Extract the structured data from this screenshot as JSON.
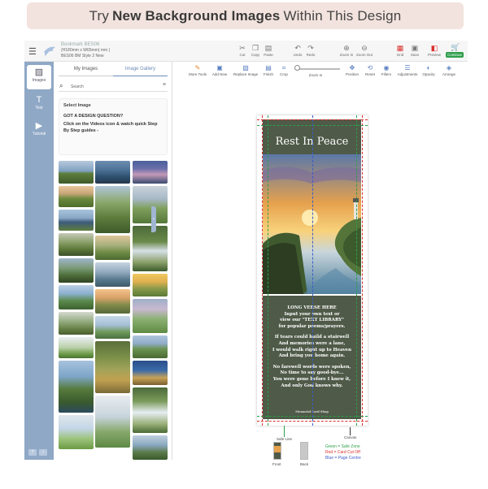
{
  "banner": {
    "prefix": "Try",
    "bold": "New Background Images",
    "suffix": "Within This Design"
  },
  "doc": {
    "name": "Bookmark BES06",
    "size": "(H180mm x W65mm( mm )",
    "style": "BES06 BM Style 2 New"
  },
  "topbar": {
    "buttons": [
      {
        "label": "Cut",
        "icon": "scissors-icon"
      },
      {
        "label": "Copy",
        "icon": "copy-icon"
      },
      {
        "label": "Paste",
        "icon": "paste-icon"
      },
      {
        "label": "Undo",
        "icon": "undo-icon"
      },
      {
        "label": "Redo",
        "icon": "redo-icon"
      },
      {
        "label": "Zoom In",
        "icon": "zoom-in-icon"
      },
      {
        "label": "Zoom Out",
        "icon": "zoom-out-icon"
      },
      {
        "label": "Grid",
        "icon": "grid-icon"
      },
      {
        "label": "Save",
        "icon": "save-icon"
      },
      {
        "label": "Preview",
        "icon": "preview-icon"
      }
    ],
    "continue_label": "Continue"
  },
  "rail": {
    "items": [
      {
        "label": "Images",
        "icon": "images-icon"
      },
      {
        "label": "Text",
        "icon": "text-icon"
      },
      {
        "label": "Tutorial",
        "icon": "tutorial-icon"
      }
    ],
    "bottom": [
      "?",
      "i"
    ]
  },
  "panel": {
    "tabs": [
      "My Images",
      "Image Gallery"
    ],
    "search_placeholder": "Search",
    "select_image": "Select Image",
    "question": "GOT A DESIGN QUESTION?",
    "help_text": "Click on the Videos icon & watch quick Step By Step guides -"
  },
  "toolbar2": {
    "buttons": [
      {
        "label": "More Tools",
        "icon": "more-tools-icon"
      },
      {
        "label": "Add New",
        "icon": "add-new-icon"
      },
      {
        "label": "Replace Image",
        "icon": "replace-image-icon"
      },
      {
        "label": "Finish",
        "icon": "finish-icon"
      },
      {
        "label": "Crop",
        "icon": "crop-icon"
      },
      {
        "label": "Zoom In",
        "icon": "zoom-slider-icon"
      },
      {
        "label": "Position",
        "icon": "position-icon"
      },
      {
        "label": "Reset",
        "icon": "reset-icon"
      },
      {
        "label": "Filters",
        "icon": "filters-icon"
      },
      {
        "label": "Adjustments",
        "icon": "adjustments-icon"
      },
      {
        "label": "Opacity",
        "icon": "opacity-icon"
      },
      {
        "label": "Arrange",
        "icon": "arrange-icon"
      }
    ]
  },
  "card": {
    "title": "Rest In Peace",
    "verse1": [
      "LONG VERSE HERE",
      "Input your own text or",
      "view our \"TEXT LIBRARY\"",
      "for popular poems/prayers."
    ],
    "verse2": [
      "If tears could build a stairwell",
      "And memories were a lane,",
      "I would walk right up to Heaven",
      "And bring you home again."
    ],
    "verse3": [
      "No farewell words were spoken,",
      "No time to say good-bye...",
      "You were gone before I knew it,",
      "And only God knows why."
    ],
    "footer": "Memorial Card Shop"
  },
  "canvas_labels": {
    "safe_line": "Safe Line",
    "canvas": "Canvas",
    "front": "Front",
    "back": "Back"
  },
  "legend": [
    {
      "color": "#2e9e4b",
      "text": "Green = Safe Zone"
    },
    {
      "color": "#d9302c",
      "text": "Red = Card Cut Off"
    },
    {
      "color": "#3c5cc9",
      "text": "Blue = Page Centre"
    }
  ]
}
